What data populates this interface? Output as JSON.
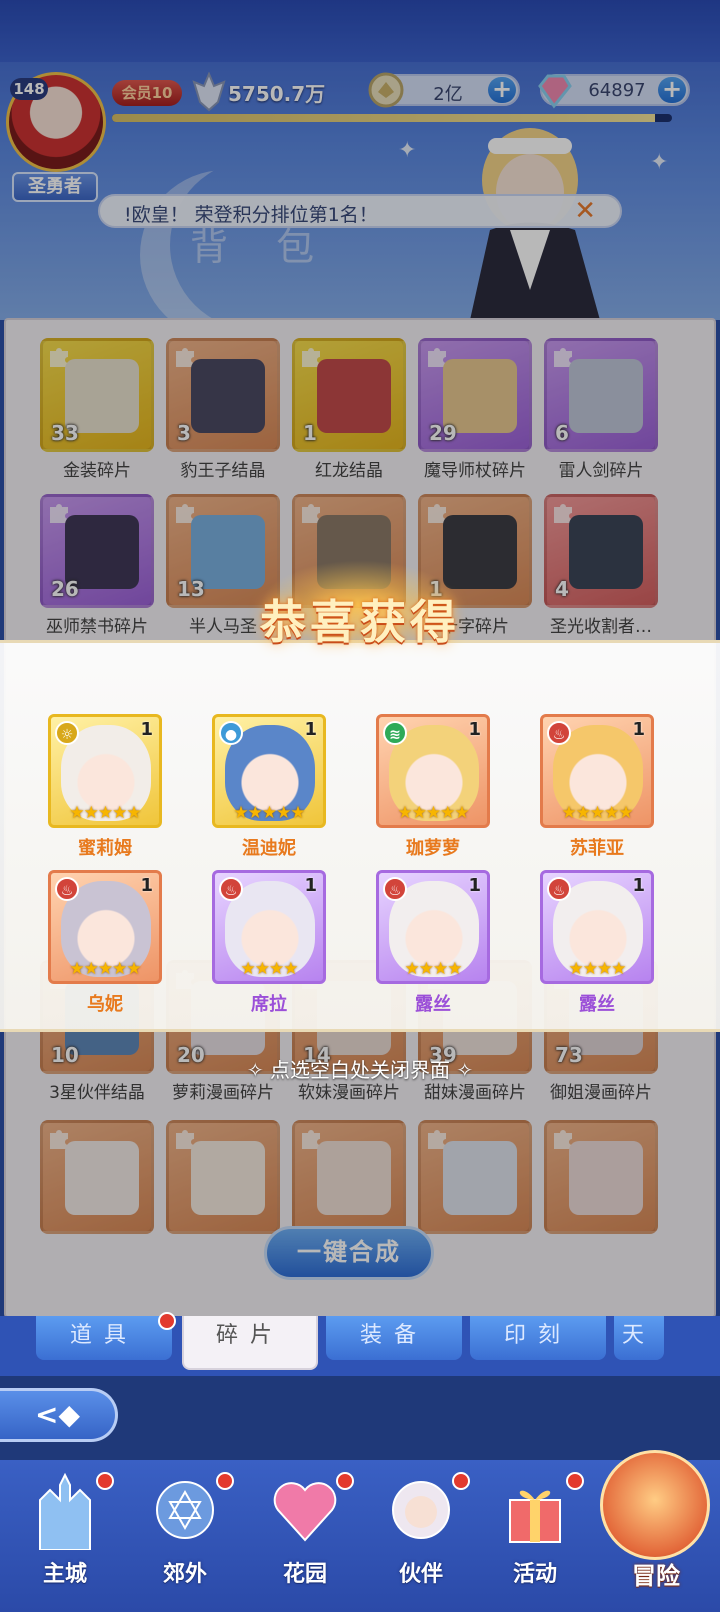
{
  "player": {
    "level": "148",
    "title": "圣勇者",
    "vip": "会员10",
    "power": "5750.7万",
    "xp_fraction": 0.97
  },
  "resources": [
    {
      "icon": "coin-icon",
      "value": "2亿"
    },
    {
      "icon": "diamond-icon",
      "value": "64897"
    }
  ],
  "notice": {
    "text": "!欧皇！ 荣登积分排位第1名！",
    "close_glyph": "✕"
  },
  "page_title": "背 包",
  "inventory": {
    "rows": [
      [
        {
          "name": "金装碎片",
          "count": "33",
          "color": "gold",
          "art": "#e9e2cf"
        },
        {
          "name": "豹王子结晶",
          "count": "3",
          "color": "orange",
          "art": "#4b4a63"
        },
        {
          "name": "红龙结晶",
          "count": "1",
          "color": "gold",
          "art": "#c24c4c"
        },
        {
          "name": "魔导师杖碎片",
          "count": "29",
          "color": "purple",
          "art": "#e8c890"
        },
        {
          "name": "雷人剑碎片",
          "count": "6",
          "color": "purple",
          "art": "#bfc6d8"
        }
      ],
      [
        {
          "name": "巫师禁书碎片",
          "count": "26",
          "color": "purple",
          "art": "#403858"
        },
        {
          "name": "半人马圣",
          "count": "13",
          "color": "orange",
          "art": "#7ab0e0"
        },
        {
          "name": "",
          "count": "",
          "color": "orange",
          "art": "#8c7b69"
        },
        {
          "name": "十字碎片",
          "count": "1",
          "color": "orange",
          "art": "#3d3d44"
        },
        {
          "name": "圣光收割者…",
          "count": "4",
          "color": "red",
          "art": "#3c4658"
        }
      ],
      [
        {
          "name": "3星伙伴结晶",
          "count": "10",
          "color": "orange",
          "art": "#5f88b9"
        },
        {
          "name": "萝莉漫画碎片",
          "count": "20",
          "color": "orange",
          "art": "#e8dfe4"
        },
        {
          "name": "软妹漫画碎片",
          "count": "14",
          "color": "orange",
          "art": "#eadbd3"
        },
        {
          "name": "甜妹漫画碎片",
          "count": "39",
          "color": "orange",
          "art": "#efe2dc"
        },
        {
          "name": "御姐漫画碎片",
          "count": "73",
          "color": "orange",
          "art": "#e0d4d6"
        }
      ],
      [
        {
          "name": "",
          "count": "",
          "color": "orange",
          "art": "#f3ebe6"
        },
        {
          "name": "",
          "count": "",
          "color": "orange",
          "art": "#f5ebe0"
        },
        {
          "name": "",
          "count": "",
          "color": "orange",
          "art": "#f0e0d6"
        },
        {
          "name": "",
          "count": "",
          "color": "orange",
          "art": "#dfe4ee"
        },
        {
          "name": "",
          "count": "",
          "color": "orange",
          "art": "#eedcd8"
        }
      ]
    ]
  },
  "synthesize_button": "一键合成",
  "reward": {
    "title": "恭喜获得",
    "close_hint": "点选空白处关闭界面",
    "heroes": [
      {
        "name": "蜜莉姆",
        "level": "1",
        "stars": "★★★★★",
        "frame": "gold",
        "name_color": "orange",
        "elem": "sun-icon",
        "elem_glyph": "☼",
        "elem_color": "#d8a81a",
        "face": "#f2ede8"
      },
      {
        "name": "温迪妮",
        "level": "1",
        "stars": "★★★★★",
        "frame": "gold",
        "name_color": "orange",
        "elem": "water-icon",
        "elem_glyph": "●",
        "elem_color": "#3e9ad8",
        "face": "#5a86c9"
      },
      {
        "name": "珈萝萝",
        "level": "1",
        "stars": "★★★★★",
        "frame": "orange",
        "name_color": "orange",
        "elem": "wind-icon",
        "elem_glyph": "≋",
        "elem_color": "#2eaa58",
        "face": "#f3d27a"
      },
      {
        "name": "苏菲亚",
        "level": "1",
        "stars": "★★★★★",
        "frame": "orange",
        "name_color": "orange",
        "elem": "fire-icon",
        "elem_glyph": "♨",
        "elem_color": "#d2443a",
        "face": "#f5c76a"
      },
      {
        "name": "乌妮",
        "level": "1",
        "stars": "★★★★★",
        "frame": "orange",
        "name_color": "orange",
        "elem": "fire-icon",
        "elem_glyph": "♨",
        "elem_color": "#d2443a",
        "face": "#c9c3d3"
      },
      {
        "name": "席拉",
        "level": "1",
        "stars": "★★★★",
        "frame": "purple",
        "name_color": "purple",
        "elem": "fire-icon",
        "elem_glyph": "♨",
        "elem_color": "#d2443a",
        "face": "#e9e6f2"
      },
      {
        "name": "露丝",
        "level": "1",
        "stars": "★★★★",
        "frame": "purple",
        "name_color": "purple",
        "elem": "fire-icon",
        "elem_glyph": "♨",
        "elem_color": "#d2443a",
        "face": "#f2eeee"
      },
      {
        "name": "露丝",
        "level": "1",
        "stars": "★★★★",
        "frame": "purple",
        "name_color": "purple",
        "elem": "fire-icon",
        "elem_glyph": "♨",
        "elem_color": "#d2443a",
        "face": "#f2eeee"
      }
    ]
  },
  "tabs": [
    {
      "label": "道具",
      "active": false,
      "badge": true
    },
    {
      "label": "碎片",
      "active": true,
      "badge": false
    },
    {
      "label": "装备",
      "active": false,
      "badge": false
    },
    {
      "label": "印刻",
      "active": false,
      "badge": false
    },
    {
      "label": "天",
      "active": false,
      "badge": false
    }
  ],
  "back_button": "<◆",
  "nav": [
    {
      "label": "主城",
      "icon": "castle-icon",
      "badge": true
    },
    {
      "label": "郊外",
      "icon": "shrine-icon",
      "badge": true
    },
    {
      "label": "花园",
      "icon": "heart-icon",
      "badge": true
    },
    {
      "label": "伙伴",
      "icon": "partner-icon",
      "badge": true
    },
    {
      "label": "活动",
      "icon": "gift-icon",
      "badge": true
    },
    {
      "label": "冒险",
      "icon": "compass-icon",
      "badge": false
    }
  ]
}
